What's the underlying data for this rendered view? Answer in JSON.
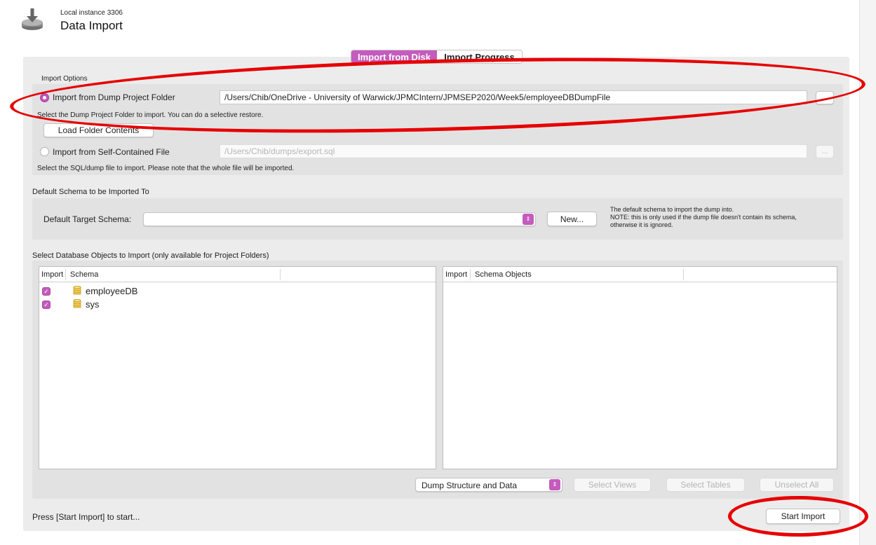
{
  "header": {
    "instance": "Local instance 3306",
    "title": "Data Import"
  },
  "tabs": [
    {
      "label": "Import from Disk",
      "active": true
    },
    {
      "label": "Import Progress",
      "active": false
    }
  ],
  "import_options": {
    "section_label": "Import Options",
    "dump_folder": {
      "label": "Import from Dump Project Folder",
      "selected": true,
      "path": "/Users/Chib/OneDrive - University of Warwick/JPMCIntern/JPMSEP2020/Week5/employeeDBDumpFile",
      "browse": "...",
      "help": "Select the Dump Project Folder to import. You can do a selective restore.",
      "load_button": "Load Folder Contents"
    },
    "self_contained": {
      "label": "Import from Self-Contained File",
      "selected": false,
      "path": "/Users/Chib/dumps/export.sql",
      "browse": "...",
      "help": "Select the SQL/dump file to import. Please note that the whole file will be imported."
    }
  },
  "default_schema": {
    "section_label": "Default Schema to be Imported To",
    "field_label": "Default Target Schema:",
    "value": "",
    "new_button": "New...",
    "note_line1": "The default schema to import the dump into.",
    "note_line2": "NOTE: this is only used if the dump file doesn't contain its schema,",
    "note_line3": "otherwise it is ignored."
  },
  "objects": {
    "section_label": "Select Database Objects to Import (only available for Project Folders)",
    "left_columns": [
      "Import",
      "Schema"
    ],
    "schemas": [
      {
        "name": "employeeDB",
        "checked": true
      },
      {
        "name": "sys",
        "checked": true
      }
    ],
    "right_columns": [
      "Import",
      "Schema Objects"
    ],
    "dump_mode": "Dump Structure and Data",
    "select_views": "Select Views",
    "select_tables": "Select Tables",
    "unselect_all": "Unselect All"
  },
  "footer": {
    "status": "Press [Start Import] to start...",
    "start_button": "Start Import"
  },
  "colors": {
    "accent": "#c45bbd",
    "annotation": "#e60000"
  },
  "icons": {
    "app": "import-arrow-icon",
    "schema": "database-icon",
    "check": "checkmark-icon",
    "popup": "updown-chevron-icon"
  }
}
